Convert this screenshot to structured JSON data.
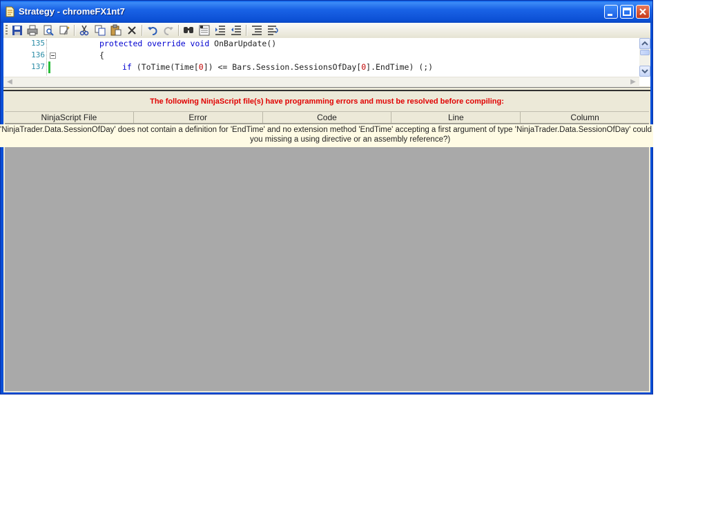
{
  "window": {
    "title": "Strategy - chromeFX1nt7"
  },
  "toolbar": {
    "buttons": [
      "save-icon",
      "print-icon",
      "print-preview-icon",
      "properties-icon",
      "cut-icon",
      "copy-icon",
      "paste-icon",
      "delete-icon",
      "undo-icon",
      "redo-icon",
      "find-icon",
      "replace-icon",
      "indent-icon",
      "outdent-icon",
      "comment-icon",
      "uncomment-icon"
    ]
  },
  "editor": {
    "lines": [
      {
        "number": "135",
        "text": "protected override void OnBarUpdate()"
      },
      {
        "number": "136",
        "text": "{"
      },
      {
        "number": "137",
        "text": "if (ToTime(Time[0]) <= Bars.Session.SessionsOfDay[0].EndTime) (;)"
      }
    ]
  },
  "errors": {
    "banner": "The following NinjaScript file(s) have programming errors and must be resolved before compiling:",
    "columns": [
      "NinjaScript File",
      "Error",
      "Code",
      "Line",
      "Column"
    ],
    "row_text_line1": "'NinjaTrader.Data.SessionOfDay' does not contain a definition for 'EndTime' and no extension method 'EndTime' accepting a first argument of type 'NinjaTrader.Data.SessionOfDay' could be found",
    "row_text_line2": "you missing a using directive or an assembly reference?)"
  },
  "colors": {
    "title_bar": "#0b4fd4",
    "error_text": "#e00000",
    "keyword": "#0000d0",
    "line_number": "#2a8ca6",
    "grid_background": "#a9a9a9"
  }
}
